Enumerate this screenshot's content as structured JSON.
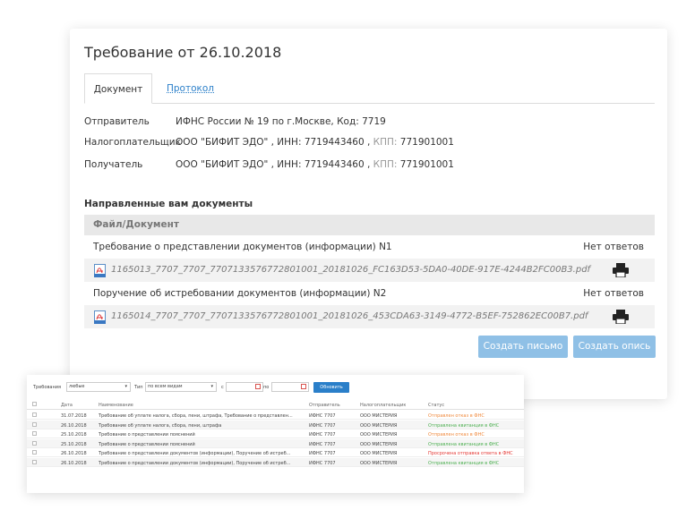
{
  "card": {
    "title": "Требование от 26.10.2018",
    "tabs": [
      {
        "label": "Документ"
      },
      {
        "label": "Протокол"
      }
    ],
    "info": [
      {
        "label": "Отправитель",
        "value": "ИФНС России № 19 по г.Москве, Код: 7719",
        "inn_label": "",
        "inn": "",
        "kpp_label": "",
        "kpp": ""
      },
      {
        "label": "Налогоплательщик",
        "value": "ООО \"БИФИТ ЭДО\" , ИНН: 7719443460 , ",
        "kpp_label": "КПП:",
        "kpp": " 771901001"
      },
      {
        "label": "Получатель",
        "value": "ООО \"БИФИТ ЭДО\" , ИНН: 7719443460 , ",
        "kpp_label": "КПП:",
        "kpp": " 771901001"
      }
    ],
    "section_title": "Направленные вам документы",
    "table_header": "Файл/Документ",
    "documents": [
      {
        "name": "Требование о представлении документов (информации) N1",
        "status": "Нет ответов",
        "file": "1165013_7707_7707_7707133576772801001_20181026_FC163D53-5DA0-40DE-917E-4244B2FC00B3.pdf"
      },
      {
        "name": "Поручение об истребовании документов (информации) N2",
        "status": "Нет ответов",
        "file": "1165014_7707_7707_7707133576772801001_20181026_453CDA63-3149-4772-B5EF-752862EC00B7.pdf"
      }
    ],
    "buttons": {
      "create_letter": "Создать письмо",
      "create_inventory": "Создать опись"
    }
  },
  "mini": {
    "filters": {
      "req_label": "Требования",
      "req_value": "любые",
      "type_label": "Тип",
      "type_value": "по всем видам",
      "from_label": "с",
      "to_label": "по",
      "refresh": "Обновить"
    },
    "headers": {
      "date": "Дата",
      "name": "Наименование",
      "sender": "Отправитель",
      "taxpayer": "Налогоплательщик",
      "status": "Статус"
    },
    "rows": [
      {
        "date": "31.07.2018",
        "name": "Требование об уплате налога, сбора, пени, штрафа, Требование о представлен...",
        "sender": "ИФНС 7707",
        "taxpayer": "ООО МИСТЕРИЯ",
        "status": "Отправлен отказ в ФНС",
        "status_color": "orange"
      },
      {
        "date": "26.10.2018",
        "name": "Требование об уплате налога, сбора, пени, штрафа",
        "sender": "ИФНС 7707",
        "taxpayer": "ООО МИСТЕРИЯ",
        "status": "Отправлена квитанция в ФНС",
        "status_color": "green"
      },
      {
        "date": "25.10.2018",
        "name": "Требование о представлении пояснений",
        "sender": "ИФНС 7707",
        "taxpayer": "ООО МИСТЕРИЯ",
        "status": "Отправлен отказ в ФНС",
        "status_color": "orange"
      },
      {
        "date": "25.10.2018",
        "name": "Требование о представлении пояснений",
        "sender": "ИФНС 7707",
        "taxpayer": "ООО МИСТЕРИЯ",
        "status": "Отправлена квитанция в ФНС",
        "status_color": "green"
      },
      {
        "date": "26.10.2018",
        "name": "Требование о представлении документов (информации), Поручение об истреб...",
        "sender": "ИФНС 7707",
        "taxpayer": "ООО МИСТЕРИЯ",
        "status": "Просрочена отправка ответа в ФНС",
        "status_color": "red"
      },
      {
        "date": "26.10.2018",
        "name": "Требование о представлении документов (информации), Поручение об истреб...",
        "sender": "ИФНС 7707",
        "taxpayer": "ООО МИСТЕРИЯ",
        "status": "Отправлена квитанция в ФНС",
        "status_color": "green"
      }
    ]
  }
}
